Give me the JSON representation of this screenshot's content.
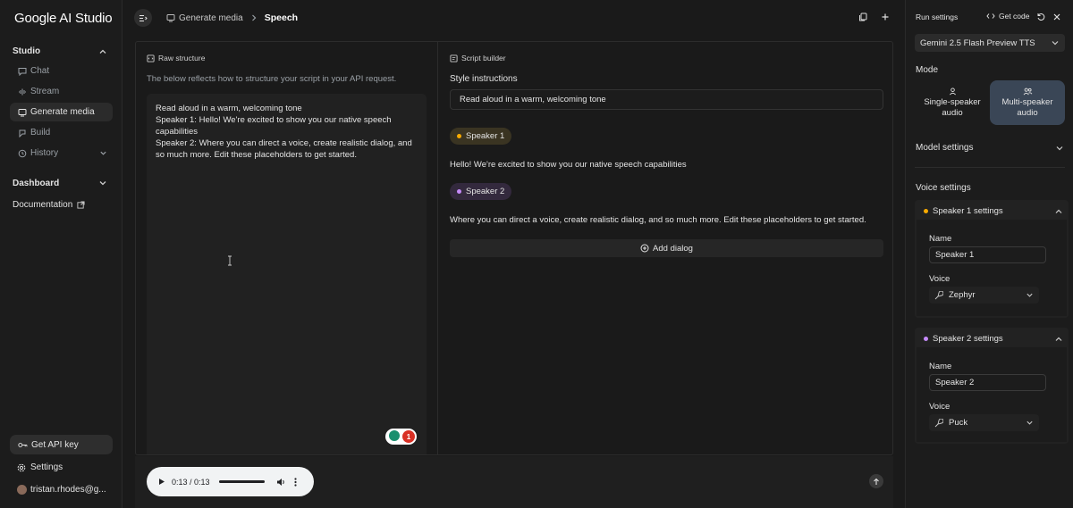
{
  "app": {
    "logo": "Google AI Studio"
  },
  "sidebar": {
    "studio_label": "Studio",
    "items": [
      {
        "label": "Chat",
        "icon": "chat-icon"
      },
      {
        "label": "Stream",
        "icon": "stream-icon"
      },
      {
        "label": "Generate media",
        "icon": "media-icon"
      },
      {
        "label": "Build",
        "icon": "build-icon"
      },
      {
        "label": "History",
        "icon": "history-icon"
      }
    ],
    "dashboard_label": "Dashboard",
    "documentation_label": "Documentation",
    "api_key_label": "Get API key",
    "settings_label": "Settings",
    "account_label": "tristan.rhodes@g..."
  },
  "topbar": {
    "breadcrumb_parent": "Generate media",
    "breadcrumb_current": "Speech"
  },
  "raw": {
    "header": "Raw structure",
    "description": "The below reflects how to structure your script in your API request.",
    "lines": [
      "Read aloud in a warm, welcoming tone",
      "Speaker 1: Hello! We're excited to show you our native speech capabilities",
      "Speaker 2: Where you can direct a voice, create realistic dialog, and so much more. Edit these placeholders to get started."
    ],
    "badge_count": "1"
  },
  "script": {
    "header": "Script builder",
    "style_label": "Style instructions",
    "style_value": "Read aloud in a warm, welcoming tone",
    "speaker1_name": "Speaker 1",
    "speaker1_text": "Hello! We're excited to show you our native speech capabilities",
    "speaker2_name": "Speaker 2",
    "speaker2_text": "Where you can direct a voice, create realistic dialog, and so much more. Edit these placeholders to get started.",
    "add_dialog_label": "Add dialog"
  },
  "player": {
    "time": "0:13 / 0:13",
    "progress": 1.0
  },
  "settings": {
    "title": "Run settings",
    "get_code_label": "Get code",
    "model": "Gemini 2.5 Flash Preview TTS",
    "mode_label": "Mode",
    "mode_single": "Single-speaker audio",
    "mode_multi": "Multi-speaker audio",
    "model_settings_label": "Model settings",
    "voice_settings_label": "Voice settings",
    "speaker1": {
      "title": "Speaker 1 settings",
      "name_label": "Name",
      "name_value": "Speaker 1",
      "voice_label": "Voice",
      "voice_value": "Zephyr"
    },
    "speaker2": {
      "title": "Speaker 2 settings",
      "name_label": "Name",
      "name_value": "Speaker 2",
      "voice_label": "Voice",
      "voice_value": "Puck"
    }
  },
  "colors": {
    "speaker1_dot": "#f9ab00",
    "speaker2_dot": "#c58af9",
    "multi_selected": "#3a4656"
  }
}
